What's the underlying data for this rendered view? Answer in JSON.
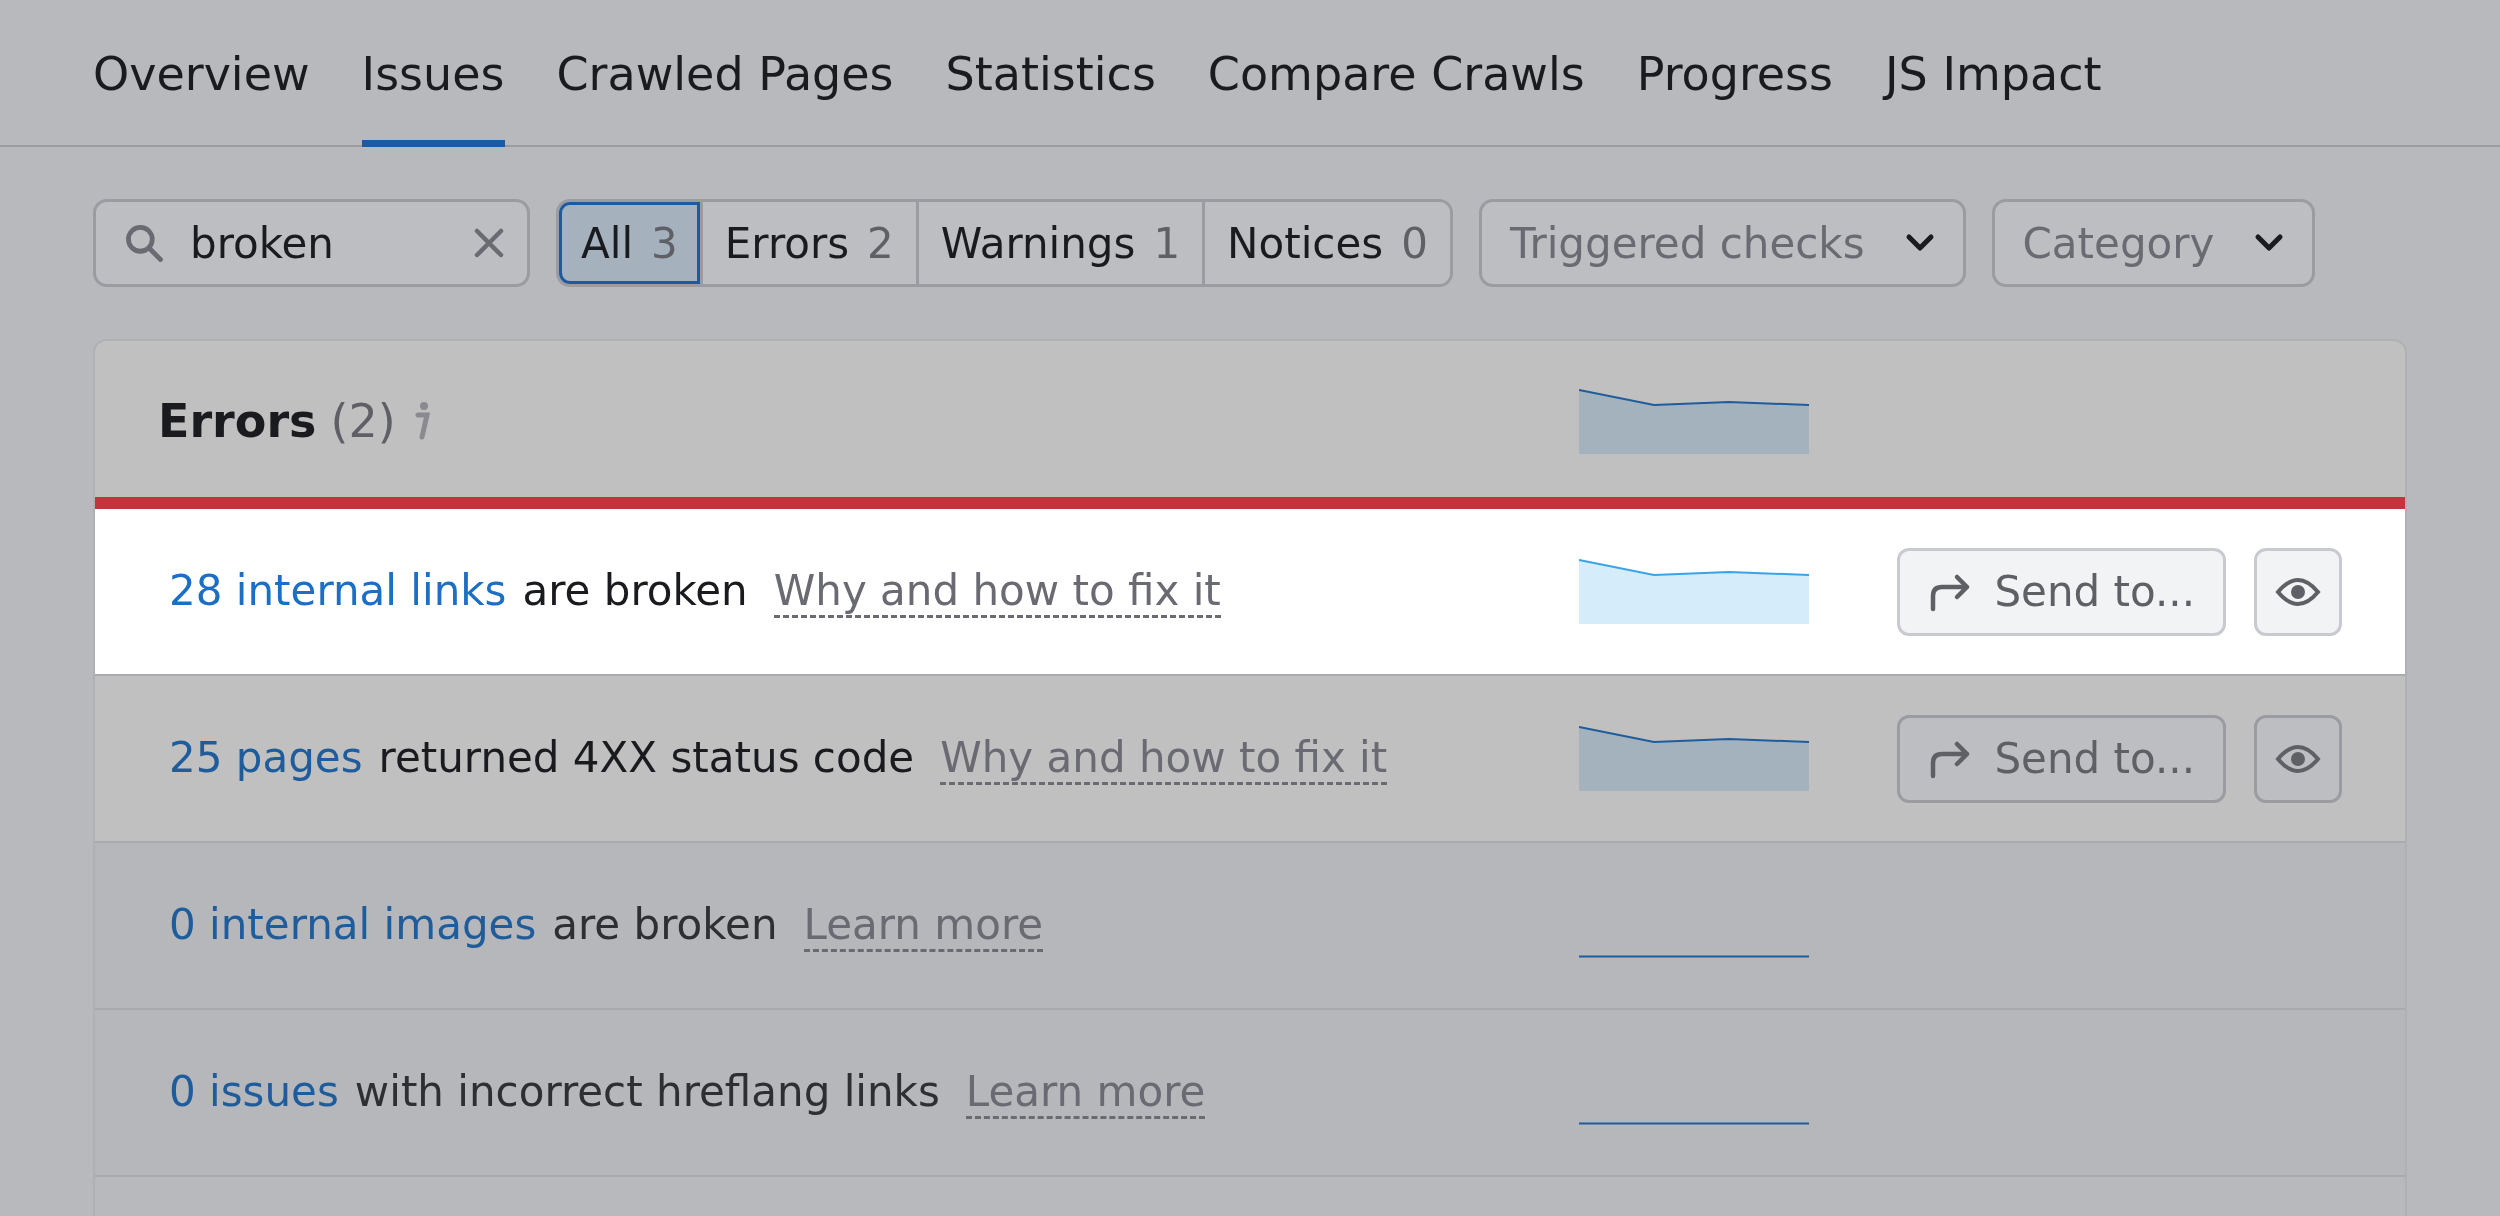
{
  "tabs": [
    {
      "label": "Overview",
      "selected": false
    },
    {
      "label": "Issues",
      "selected": true
    },
    {
      "label": "Crawled Pages",
      "selected": false
    },
    {
      "label": "Statistics",
      "selected": false
    },
    {
      "label": "Compare Crawls",
      "selected": false
    },
    {
      "label": "Progress",
      "selected": false
    },
    {
      "label": "JS Impact",
      "selected": false
    }
  ],
  "search": {
    "value": "broken"
  },
  "filters": [
    {
      "label": "All",
      "count": "3",
      "selected": true
    },
    {
      "label": "Errors",
      "count": "2",
      "selected": false
    },
    {
      "label": "Warnings",
      "count": "1",
      "selected": false
    },
    {
      "label": "Notices",
      "count": "0",
      "selected": false
    }
  ],
  "dropdowns": [
    "Triggered checks",
    "Category"
  ],
  "section": {
    "title": "Errors",
    "count": "(2)"
  },
  "issues": [
    {
      "link": "28 internal links",
      "text": "are broken",
      "help": "Why and how to fix it",
      "selected": true,
      "disabled": false,
      "send_label": "Send to..."
    },
    {
      "link": "25 pages",
      "text": "returned 4XX status code",
      "help": "Why and how to fix it",
      "selected": false,
      "disabled": false,
      "send_label": "Send to..."
    },
    {
      "link": "0 internal images",
      "text": "are broken",
      "help": "Learn more",
      "selected": false,
      "disabled": true
    },
    {
      "link": "0 issues",
      "text": "with incorrect hreflang links",
      "help": "Learn more",
      "selected": false,
      "disabled": true
    }
  ]
}
